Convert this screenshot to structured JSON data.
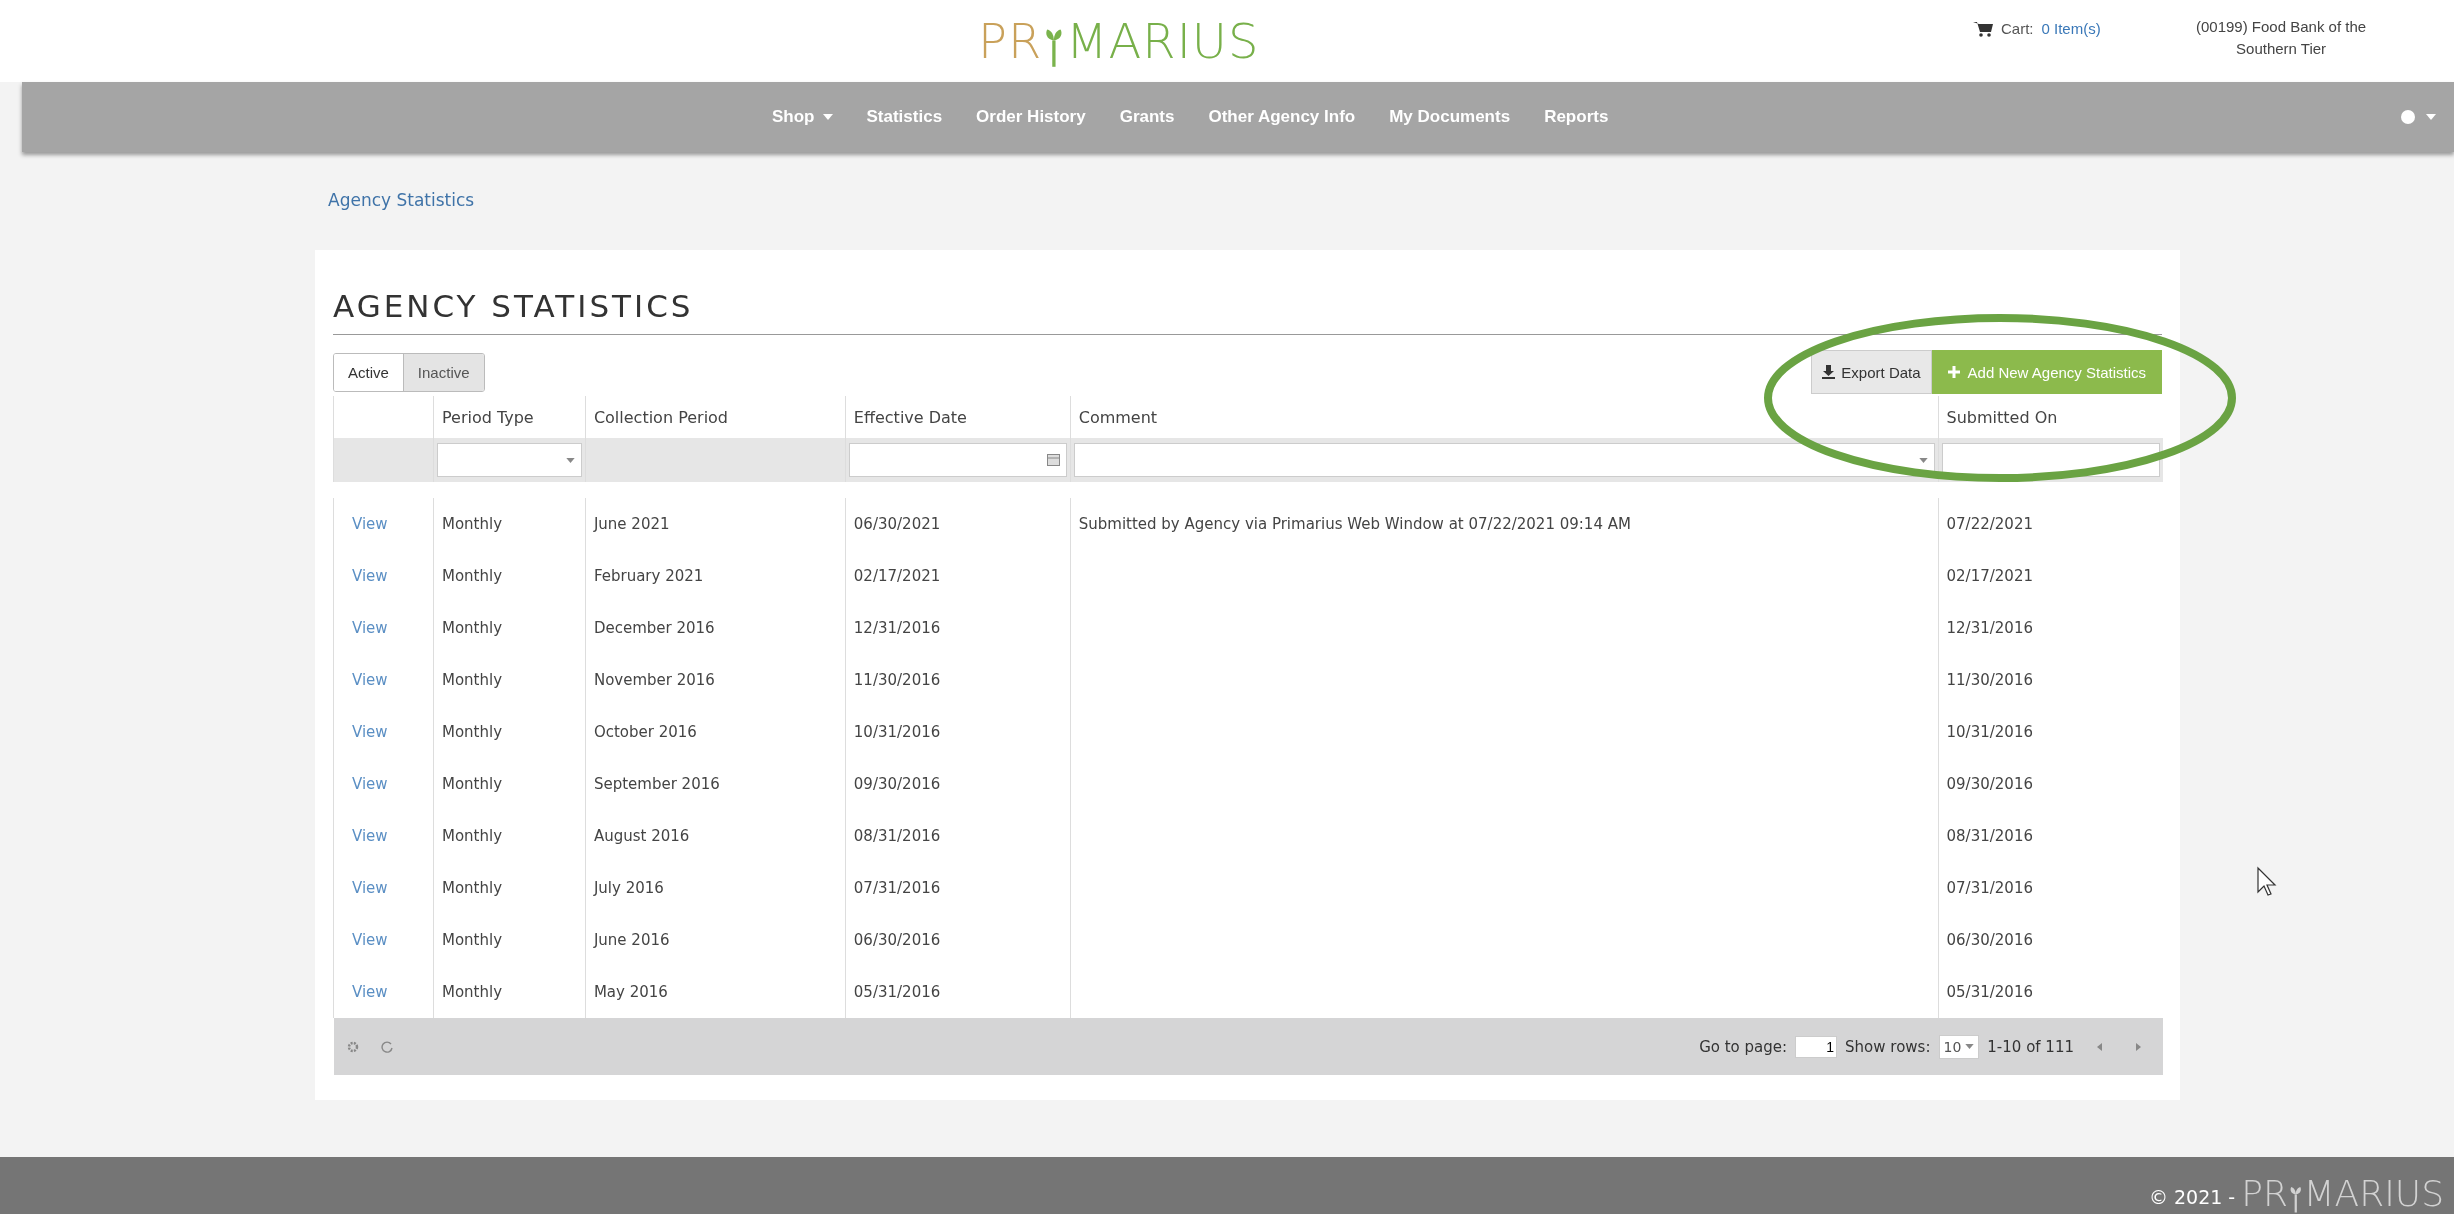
{
  "header": {
    "logo": {
      "left": "PR",
      "right": "MARIUS"
    },
    "cart": {
      "label": "Cart:",
      "count": "0 Item(s)"
    },
    "agency": [
      "(00199) Food Bank of the",
      "Southern Tier"
    ]
  },
  "nav": {
    "items": [
      {
        "label": "Shop",
        "dropdown": true
      },
      {
        "label": "Statistics",
        "dropdown": false
      },
      {
        "label": "Order History",
        "dropdown": false
      },
      {
        "label": "Grants",
        "dropdown": false
      },
      {
        "label": "Other Agency Info",
        "dropdown": false
      },
      {
        "label": "My Documents",
        "dropdown": false
      },
      {
        "label": "Reports",
        "dropdown": false
      }
    ]
  },
  "breadcrumb": "Agency Statistics",
  "panel": {
    "title": "AGENCY STATISTICS",
    "toggle": [
      {
        "label": "Active",
        "selected": true
      },
      {
        "label": "Inactive",
        "selected": false
      }
    ],
    "export_button": "Export Data",
    "add_button": "Add New Agency Statistics",
    "columns": [
      "Period Type",
      "Collection Period",
      "Effective Date",
      "Comment",
      "Submitted On"
    ],
    "rows": [
      {
        "link": "View",
        "cells": [
          "Monthly",
          "June 2021",
          "06/30/2021",
          "Submitted by Agency via Primarius Web Window at 07/22/2021 09:14 AM",
          "07/22/2021"
        ]
      },
      {
        "link": "View",
        "cells": [
          "Monthly",
          "February 2021",
          "02/17/2021",
          "",
          "02/17/2021"
        ]
      },
      {
        "link": "View",
        "cells": [
          "Monthly",
          "December 2016",
          "12/31/2016",
          "",
          "12/31/2016"
        ]
      },
      {
        "link": "View",
        "cells": [
          "Monthly",
          "November 2016",
          "11/30/2016",
          "",
          "11/30/2016"
        ]
      },
      {
        "link": "View",
        "cells": [
          "Monthly",
          "October 2016",
          "10/31/2016",
          "",
          "10/31/2016"
        ]
      },
      {
        "link": "View",
        "cells": [
          "Monthly",
          "September 2016",
          "09/30/2016",
          "",
          "09/30/2016"
        ]
      },
      {
        "link": "View",
        "cells": [
          "Monthly",
          "August 2016",
          "08/31/2016",
          "",
          "08/31/2016"
        ]
      },
      {
        "link": "View",
        "cells": [
          "Monthly",
          "July 2016",
          "07/31/2016",
          "",
          "07/31/2016"
        ]
      },
      {
        "link": "View",
        "cells": [
          "Monthly",
          "June 2016",
          "06/30/2016",
          "",
          "06/30/2016"
        ]
      },
      {
        "link": "View",
        "cells": [
          "Monthly",
          "May 2016",
          "05/31/2016",
          "",
          "05/31/2016"
        ]
      }
    ],
    "pager": {
      "goto_label": "Go to page:",
      "page": "1",
      "rows_label": "Show rows:",
      "rows_value": "10",
      "range": "1-10 of 111"
    }
  },
  "footer": {
    "copyright": "© 2021 -",
    "logo": {
      "left": "PR",
      "right": "MARIUS"
    }
  }
}
